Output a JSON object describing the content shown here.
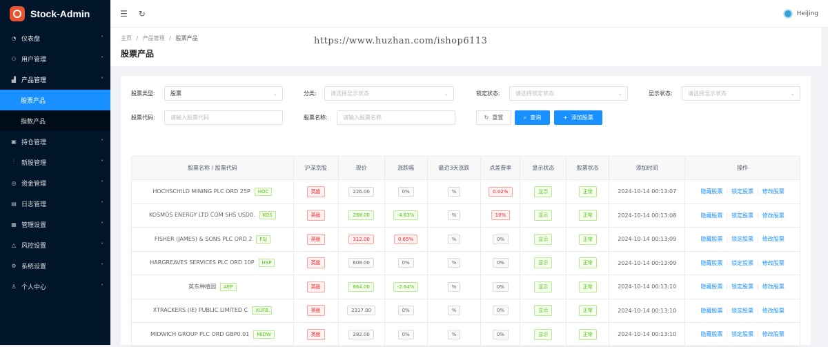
{
  "app": {
    "name": "Stock-Admin"
  },
  "user": {
    "name": "HeiJing"
  },
  "watermark": "https://www.huzhan.com/ishop6113",
  "sidebar": {
    "items": [
      {
        "label": "仪表盘",
        "icon": "dashboard-icon"
      },
      {
        "label": "用户管理",
        "icon": "users-icon"
      },
      {
        "label": "产品管理",
        "icon": "chart-icon",
        "open": true
      },
      {
        "label": "持仓管理",
        "icon": "position-icon"
      },
      {
        "label": "新股管理",
        "icon": "newstock-icon"
      },
      {
        "label": "资金管理",
        "icon": "money-icon"
      },
      {
        "label": "日志管理",
        "icon": "log-icon"
      },
      {
        "label": "管理设置",
        "icon": "admin-icon"
      },
      {
        "label": "风控设置",
        "icon": "warning-icon"
      },
      {
        "label": "系统设置",
        "icon": "gear-icon"
      },
      {
        "label": "个人中心",
        "icon": "person-icon"
      }
    ],
    "sub_items": [
      {
        "label": "股票产品",
        "active": true
      },
      {
        "label": "指数产品",
        "active": false
      }
    ]
  },
  "breadcrumb": {
    "home": "主页",
    "sep": "/",
    "level1": "产品管理",
    "current": "股票产品"
  },
  "page_title": "股票产品",
  "filters": {
    "stock_type": {
      "label": "股票类型:",
      "value": "股票"
    },
    "category": {
      "label": "分类:",
      "placeholder": "请选择显示状态"
    },
    "lock_status": {
      "label": "锁定状态:",
      "placeholder": "请选择锁定状态"
    },
    "display_status": {
      "label": "显示状态:",
      "placeholder": "请选择显示状态"
    },
    "stock_code": {
      "label": "股票代码:",
      "placeholder": "请输入股票代码"
    },
    "stock_name": {
      "label": "股票名称:",
      "placeholder": "请输入股票名称"
    }
  },
  "buttons": {
    "reset": "重置",
    "search": "查询",
    "add": "添加股票"
  },
  "table": {
    "columns": [
      "股票名称 / 股票代码",
      "沪深京股",
      "现价",
      "涨跌幅",
      "最近3天涨跌",
      "点差费率",
      "显示状态",
      "股票状态",
      "添加时间",
      "操作"
    ],
    "rows": [
      {
        "name": "HOCHSCHILD MINING PLC ORD 25P",
        "code": "HOC",
        "market": "英股",
        "price": "226.00",
        "price_style": "",
        "change": "0%",
        "change_style": "",
        "three_day": "%",
        "spread": "0.02%",
        "spread_style": "red",
        "display": "显示",
        "status": "正常",
        "time": "2024-10-14 00:13:07"
      },
      {
        "name": "KOSMOS ENERGY LTD COM SHS USD0.",
        "code": "KOS",
        "market": "英股",
        "price": "268.00",
        "price_style": "green",
        "change": "-4.63%",
        "change_style": "green",
        "three_day": "%",
        "spread": "10%",
        "spread_style": "red",
        "display": "显示",
        "status": "正常",
        "time": "2024-10-14 00:13:08"
      },
      {
        "name": "FISHER (JAMES) & SONS PLC ORD 2",
        "code": "FSJ",
        "market": "英股",
        "price": "312.00",
        "price_style": "red",
        "change": "0.65%",
        "change_style": "red",
        "three_day": "%",
        "spread": "0%",
        "spread_style": "",
        "display": "显示",
        "status": "正常",
        "time": "2024-10-14 00:13:09"
      },
      {
        "name": "HARGREAVES SERVICES PLC ORD 10P",
        "code": "HSP",
        "market": "英股",
        "price": "608.00",
        "price_style": "",
        "change": "0%",
        "change_style": "",
        "three_day": "%",
        "spread": "0%",
        "spread_style": "",
        "display": "显示",
        "status": "正常",
        "time": "2024-10-14 00:13:09"
      },
      {
        "name": "英东种植园",
        "code": "AEP",
        "market": "英股",
        "price": "664.00",
        "price_style": "green",
        "change": "-2.64%",
        "change_style": "green",
        "three_day": "%",
        "spread": "0%",
        "spread_style": "",
        "display": "显示",
        "status": "正常",
        "time": "2024-10-14 00:13:10"
      },
      {
        "name": "XTRACKERS (IE) PUBLIC LIMITED C",
        "code": "XUFB",
        "market": "英股",
        "price": "2317.00",
        "price_style": "",
        "change": "0%",
        "change_style": "",
        "three_day": "%",
        "spread": "0%",
        "spread_style": "",
        "display": "显示",
        "status": "正常",
        "time": "2024-10-14 00:13:10"
      },
      {
        "name": "MIDWICH GROUP PLC ORD GBP0.01",
        "code": "MIDW",
        "market": "英股",
        "price": "282.00",
        "price_style": "",
        "change": "0%",
        "change_style": "",
        "three_day": "%",
        "spread": "0%",
        "spread_style": "",
        "display": "显示",
        "status": "正常",
        "time": "2024-10-14 00:13:10"
      }
    ],
    "ops": [
      "隐藏股票",
      "锁定股票",
      "修改股票"
    ]
  }
}
